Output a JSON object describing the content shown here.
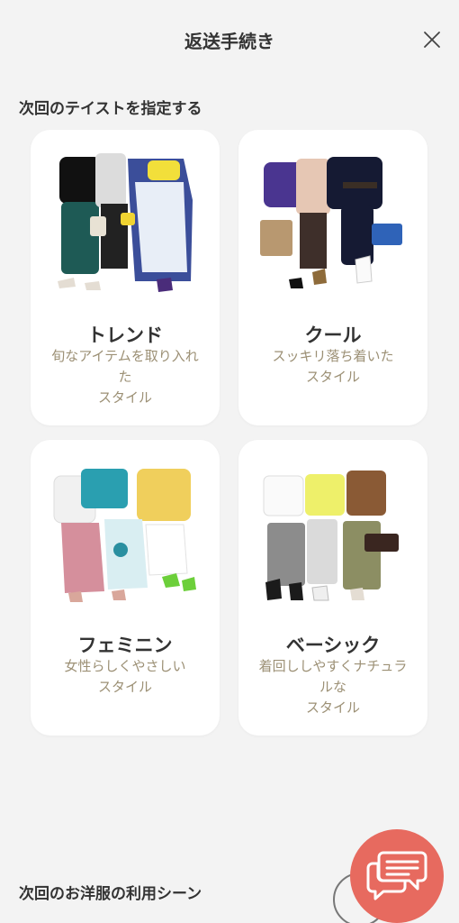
{
  "header": {
    "title": "返送手続き",
    "close_icon": "close-icon"
  },
  "taste_section": {
    "title": "次回のテイストを指定する",
    "cards": [
      {
        "name": "トレンド",
        "description": "旬なアイテムを取り入れ\nた\nスタイル",
        "image": "outfit-image"
      },
      {
        "name": "クール",
        "description": "スッキリ落ち着いた\nスタイル",
        "image": "outfit-image"
      },
      {
        "name": "フェミニン",
        "description": "女性らしくやさしい\nスタイル",
        "image": "outfit-image"
      },
      {
        "name": "ベーシック",
        "description": "着回ししやすくナチュラ\nルな\nスタイル",
        "image": "outfit-image"
      }
    ]
  },
  "scene_section": {
    "title": "次回のお洋服の利用シーン"
  },
  "chat_button": {
    "icon": "chat-bubbles-icon",
    "color": "#e76a5f"
  },
  "colors": {
    "background": "#f3f3f3",
    "card": "#ffffff",
    "description": "#9c9075",
    "text": "#333333"
  }
}
